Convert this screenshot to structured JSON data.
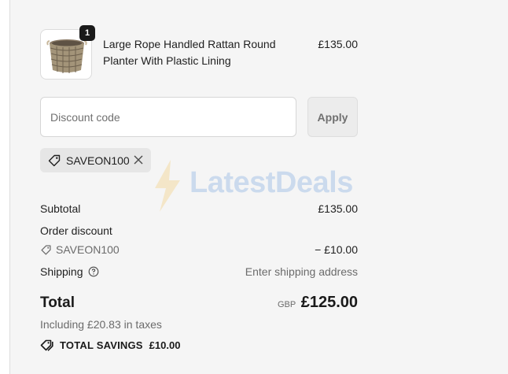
{
  "product": {
    "title": "Large Rope Handled Rattan Round Planter With Plastic Lining",
    "price": "£135.00",
    "quantity": "1"
  },
  "discount": {
    "placeholder": "Discount code",
    "apply_label": "Apply",
    "applied_code": "SAVEON100"
  },
  "watermark": {
    "text": "LatestDeals"
  },
  "summary": {
    "subtotal_label": "Subtotal",
    "subtotal_value": "£135.00",
    "order_discount_label": "Order discount",
    "discount_code": "SAVEON100",
    "discount_value": "− £10.00",
    "shipping_label": "Shipping",
    "shipping_value": "Enter shipping address",
    "total_label": "Total",
    "currency": "GBP",
    "total_value": "£125.00",
    "tax_note": "Including £20.83 in taxes",
    "savings_label": "TOTAL SAVINGS",
    "savings_value": "£10.00"
  },
  "icons": {
    "tag": "tag-icon",
    "close": "close-icon",
    "help": "help-circle-icon",
    "savings": "savings-tag-icon",
    "product_image": "rattan-planter-image"
  },
  "colors": {
    "panel_background": "#f5f5f5",
    "chip_background": "#e6e6e6",
    "badge_background": "#1a1a1a",
    "watermark_blue": "#3a7fd5",
    "watermark_yellow": "#f2b32b"
  }
}
